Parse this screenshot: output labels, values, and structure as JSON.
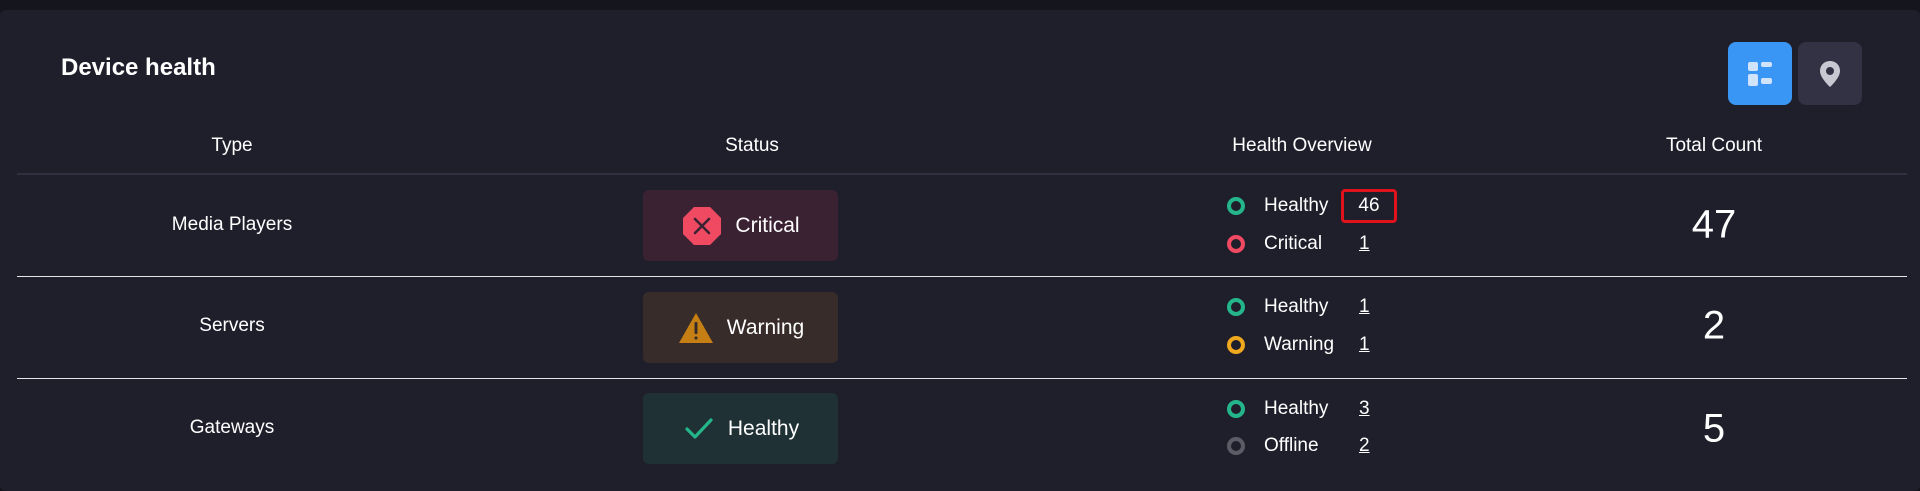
{
  "panel": {
    "title": "Device health",
    "view_toggle": [
      {
        "name": "list-view",
        "icon": "list-layout-icon",
        "active": true
      },
      {
        "name": "map-view",
        "icon": "map-pin-icon",
        "active": false
      }
    ]
  },
  "table": {
    "columns": [
      "Type",
      "Status",
      "Health Overview",
      "Total Count"
    ],
    "rows": [
      {
        "type": "Media Players",
        "status": {
          "label": "Critical",
          "icon": "critical-octagon-icon",
          "color": "#ef4a62"
        },
        "health": [
          {
            "label": "Healthy",
            "count": "46",
            "color": "#24b68a"
          },
          {
            "label": "Critical",
            "count": "1",
            "color": "#ef4a62"
          }
        ],
        "total": "47"
      },
      {
        "type": "Servers",
        "status": {
          "label": "Warning",
          "icon": "warning-triangle-icon",
          "color": "#f0a81e"
        },
        "health": [
          {
            "label": "Healthy",
            "count": "1",
            "color": "#24b68a"
          },
          {
            "label": "Warning",
            "count": "1",
            "color": "#f0a81e"
          }
        ],
        "total": "2"
      },
      {
        "type": "Gateways",
        "status": {
          "label": "Healthy",
          "icon": "check-icon",
          "color": "#24b68a"
        },
        "health": [
          {
            "label": "Healthy",
            "count": "3",
            "color": "#24b68a"
          },
          {
            "label": "Offline",
            "count": "2",
            "color": "#5c5c66"
          }
        ],
        "total": "5"
      }
    ]
  },
  "colors": {
    "accent": "#3a96f5",
    "critical": "#ef4a62",
    "warning": "#f0a81e",
    "healthy": "#24b68a",
    "offline": "#5c5c66",
    "highlight_box": "#e0121c"
  }
}
